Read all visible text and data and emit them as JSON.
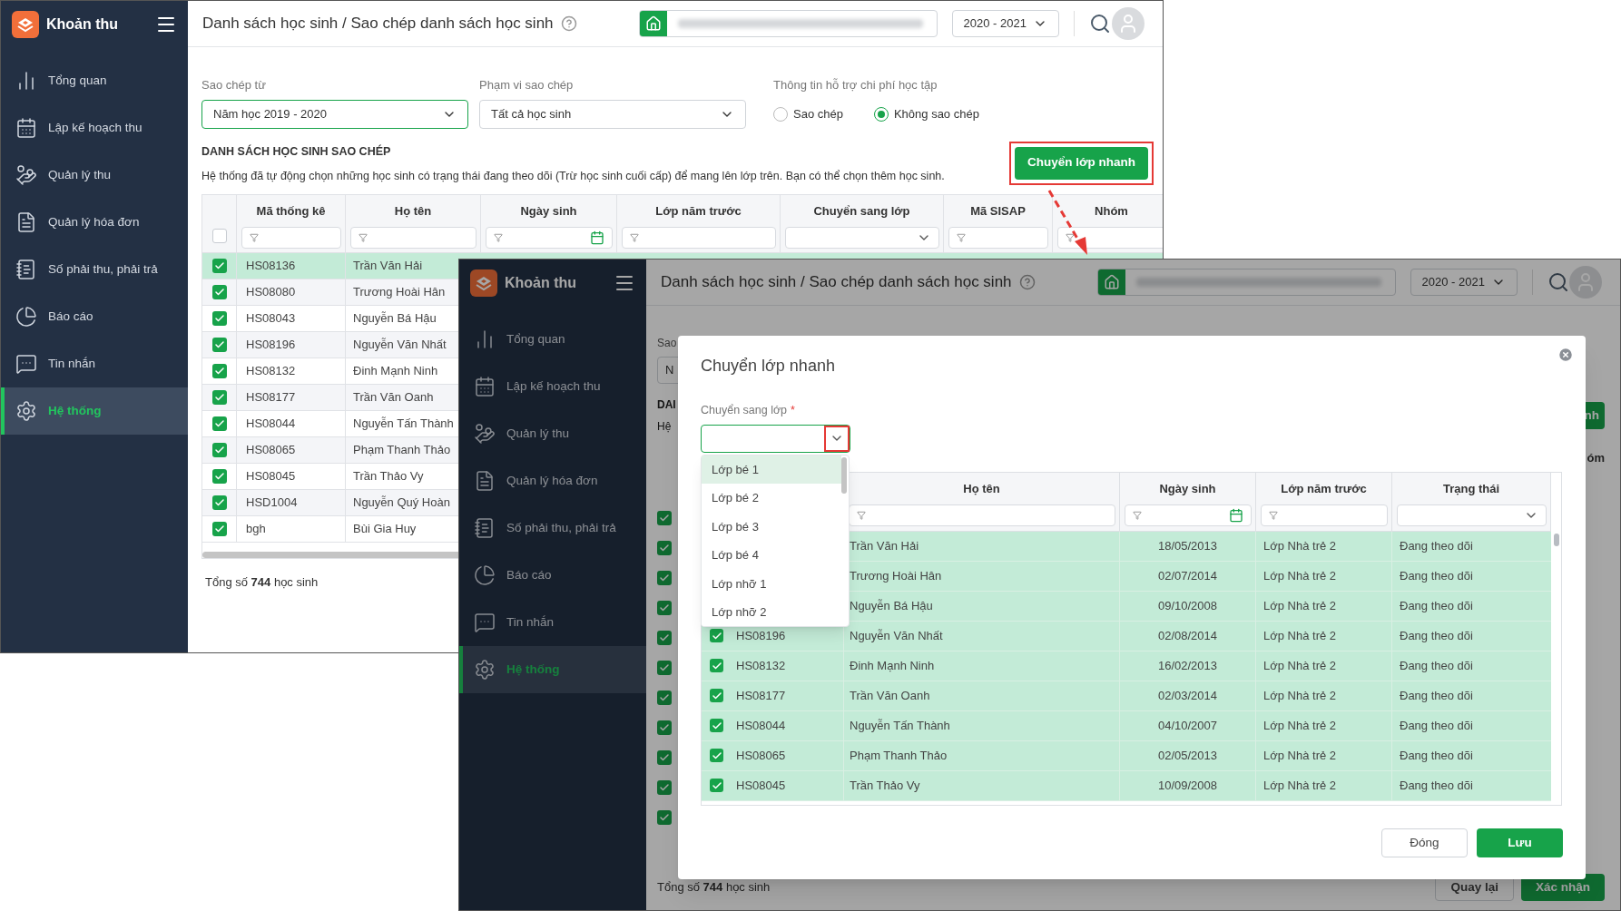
{
  "back_window": {
    "sidebar": {
      "app_name": "Khoản thu",
      "items": [
        {
          "label": "Tổng quan",
          "selected": false
        },
        {
          "label": "Lập kế hoạch thu",
          "selected": false
        },
        {
          "label": "Quản lý thu",
          "selected": false
        },
        {
          "label": "Quản lý hóa đơn",
          "selected": false
        },
        {
          "label": "Số phải thu, phải trả",
          "selected": false
        },
        {
          "label": "Báo cáo",
          "selected": false
        },
        {
          "label": "Tin nhắn",
          "selected": false
        },
        {
          "label": "Hệ thống",
          "selected": true
        }
      ]
    },
    "header": {
      "title": "Danh sách học sinh / Sao chép danh sách học sinh",
      "year": "2020 - 2021"
    },
    "filters": [
      {
        "label": "Sao chép từ",
        "value": "Năm học 2019 - 2020",
        "focused": true
      },
      {
        "label": "Phạm vi sao chép",
        "value": "Tất cả học sinh",
        "focused": false
      }
    ],
    "support_info": {
      "label": "Thông tin hỗ trợ chi phí học tập",
      "options": [
        {
          "label": "Sao chép",
          "selected": false
        },
        {
          "label": "Không sao chép",
          "selected": true
        }
      ]
    },
    "section_title": "DANH SÁCH HỌC SINH SAO CHÉP",
    "description": "Hệ thống đã tự động chọn những học sinh có trạng thái đang theo dõi (Trừ học sinh cuối cấp) để mang lên lớp trên. Bạn có thể chọn thêm học sinh.",
    "quick_button": {
      "label": "Chuyển lớp nhanh",
      "highlighted": true
    },
    "table": {
      "header_checked": false,
      "columns": [
        {
          "label": "Mã thống kê",
          "kind": "text"
        },
        {
          "label": "Họ tên",
          "kind": "text"
        },
        {
          "label": "Ngày sinh",
          "kind": "date"
        },
        {
          "label": "Lớp năm trước",
          "kind": "text"
        },
        {
          "label": "Chuyển sang lớp",
          "kind": "select"
        },
        {
          "label": "Mã SISAP",
          "kind": "text"
        },
        {
          "label": "Nhóm",
          "kind": "text"
        }
      ],
      "rows": [
        {
          "checked": true,
          "selected": true,
          "code": "HS08136",
          "name": "Trần Văn Hải"
        },
        {
          "checked": true,
          "selected": false,
          "code": "HS08080",
          "name": "Trương Hoài Hân"
        },
        {
          "checked": true,
          "selected": false,
          "code": "HS08043",
          "name": "Nguyễn Bá Hậu"
        },
        {
          "checked": true,
          "selected": false,
          "code": "HS08196",
          "name": "Nguyễn Văn Nhất"
        },
        {
          "checked": true,
          "selected": false,
          "code": "HS08132",
          "name": "Đinh Mạnh Ninh"
        },
        {
          "checked": true,
          "selected": false,
          "code": "HS08177",
          "name": "Trần Văn Oanh"
        },
        {
          "checked": true,
          "selected": false,
          "code": "HS08044",
          "name": "Nguyễn Tấn Thành"
        },
        {
          "checked": true,
          "selected": false,
          "code": "HS08065",
          "name": "Phạm Thanh Thảo"
        },
        {
          "checked": true,
          "selected": false,
          "code": "HS08045",
          "name": "Trần Thảo Vy"
        },
        {
          "checked": true,
          "selected": false,
          "code": "HSD1004",
          "name": "Nguyễn Quý Hoàn"
        },
        {
          "checked": true,
          "selected": false,
          "code": "bgh",
          "name": "Bùi Gia Huy"
        }
      ]
    },
    "total": "Tổng số **744** học sinh"
  },
  "front_window": {
    "sidebar": {
      "app_name": "Khoản thu",
      "items": [
        {
          "label": "Tổng quan",
          "selected": false
        },
        {
          "label": "Lập kế hoạch thu",
          "selected": false
        },
        {
          "label": "Quản lý thu",
          "selected": false
        },
        {
          "label": "Quản lý hóa đơn",
          "selected": false
        },
        {
          "label": "Số phải thu, phải trả",
          "selected": false
        },
        {
          "label": "Báo cáo",
          "selected": false
        },
        {
          "label": "Tin nhắn",
          "selected": false
        },
        {
          "label": "Hệ thống",
          "selected": true
        }
      ]
    },
    "header": {
      "title": "Danh sách học sinh / Sao chép danh sách học sinh",
      "year": "2020 - 2021"
    },
    "background_texts": {
      "copy_from_label": "Sao",
      "copy_from_value": "N",
      "section_title": "DAI",
      "description": "Hệ",
      "button": "nh",
      "column": "óm"
    },
    "background_rows": [
      {
        "checked": true
      },
      {
        "checked": true
      },
      {
        "checked": true
      },
      {
        "checked": true
      },
      {
        "checked": true
      },
      {
        "checked": true
      },
      {
        "checked": true
      },
      {
        "checked": true
      },
      {
        "checked": true
      },
      {
        "checked": true
      },
      {
        "checked": true
      }
    ],
    "total": "Tổng số **744** học sinh",
    "buttons": [
      {
        "label": "Quay lại",
        "kind": "secondary"
      },
      {
        "label": "Xác nhận",
        "kind": "primary"
      }
    ]
  },
  "modal": {
    "title": "Chuyển lớp nhanh",
    "field": {
      "label": "Chuyển sang lớp",
      "required_mark": "*",
      "chevron_highlighted": true
    },
    "options": [
      {
        "label": "Lớp bé 1",
        "selected": true
      },
      {
        "label": "Lớp bé 2",
        "selected": false
      },
      {
        "label": "Lớp bé 3",
        "selected": false
      },
      {
        "label": "Lớp bé 4",
        "selected": false
      },
      {
        "label": "Lớp nhỡ 1",
        "selected": false
      },
      {
        "label": "Lớp nhỡ 2",
        "selected": false
      }
    ],
    "table": {
      "columns": [
        {
          "label": "Họ tên",
          "kind": "text"
        },
        {
          "label": "Ngày sinh",
          "kind": "date"
        },
        {
          "label": "Lớp năm trước",
          "kind": "text"
        },
        {
          "label": "Trạng thái",
          "kind": "select"
        }
      ],
      "rows": [
        {
          "name": "Trần Văn Hải",
          "birth": "18/05/2013",
          "previous_class": "Lớp Nhà trẻ 2",
          "status": "Đang theo dõi"
        },
        {
          "name": "Trương Hoài Hân",
          "birth": "02/07/2014",
          "previous_class": "Lớp Nhà trẻ 2",
          "status": "Đang theo dõi"
        },
        {
          "name": "Nguyễn Bá Hậu",
          "birth": "09/10/2008",
          "previous_class": "Lớp Nhà trẻ 2",
          "status": "Đang theo dõi"
        },
        {
          "checked": true,
          "code": "HS08196",
          "name": "Nguyễn Văn Nhất",
          "birth": "02/08/2014",
          "previous_class": "Lớp Nhà trẻ 2",
          "status": "Đang theo dõi"
        },
        {
          "checked": true,
          "code": "HS08132",
          "name": "Đinh Mạnh Ninh",
          "birth": "16/02/2013",
          "previous_class": "Lớp Nhà trẻ 2",
          "status": "Đang theo dõi"
        },
        {
          "checked": true,
          "code": "HS08177",
          "name": "Trần Văn Oanh",
          "birth": "02/03/2014",
          "previous_class": "Lớp Nhà trẻ 2",
          "status": "Đang theo dõi"
        },
        {
          "checked": true,
          "code": "HS08044",
          "name": "Nguyễn Tấn Thành",
          "birth": "04/10/2007",
          "previous_class": "Lớp Nhà trẻ 2",
          "status": "Đang theo dõi"
        },
        {
          "checked": true,
          "code": "HS08065",
          "name": "Phạm Thanh Thảo",
          "birth": "02/05/2013",
          "previous_class": "Lớp Nhà trẻ 2",
          "status": "Đang theo dõi"
        },
        {
          "checked": true,
          "code": "HS08045",
          "name": "Trần Thảo Vy",
          "birth": "10/09/2008",
          "previous_class": "Lớp Nhà trẻ 2",
          "status": "Đang theo dõi"
        }
      ]
    },
    "buttons": [
      {
        "label": "Đóng",
        "kind": "secondary"
      },
      {
        "label": "Lưu",
        "kind": "primary"
      }
    ]
  }
}
